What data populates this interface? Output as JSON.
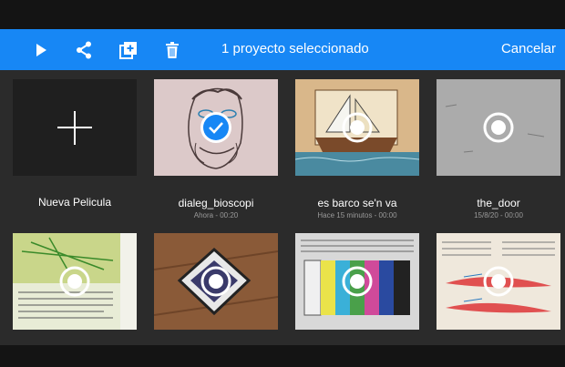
{
  "toolbar": {
    "title": "1 proyecto seleccionado",
    "cancel_label": "Cancelar",
    "icons": [
      "play-icon",
      "share-icon",
      "duplicate-icon",
      "delete-icon"
    ],
    "accent_color": "#1787f5"
  },
  "projects": [
    {
      "name": "Nueva Pelicula",
      "meta": "",
      "state": "new"
    },
    {
      "name": "dialeg_bioscopi",
      "meta": "Ahora - 00:20",
      "state": "selected"
    },
    {
      "name": "es barco se'n va",
      "meta": "Hace 15 minutos - 00:00",
      "state": "unselected"
    },
    {
      "name": "the_door",
      "meta": "15/8/20 - 00:00",
      "state": "unselected"
    },
    {
      "name": "",
      "meta": "",
      "state": "unselected"
    },
    {
      "name": "",
      "meta": "",
      "state": "unselected"
    },
    {
      "name": "",
      "meta": "",
      "state": "unselected"
    },
    {
      "name": "",
      "meta": "",
      "state": "unselected"
    }
  ]
}
